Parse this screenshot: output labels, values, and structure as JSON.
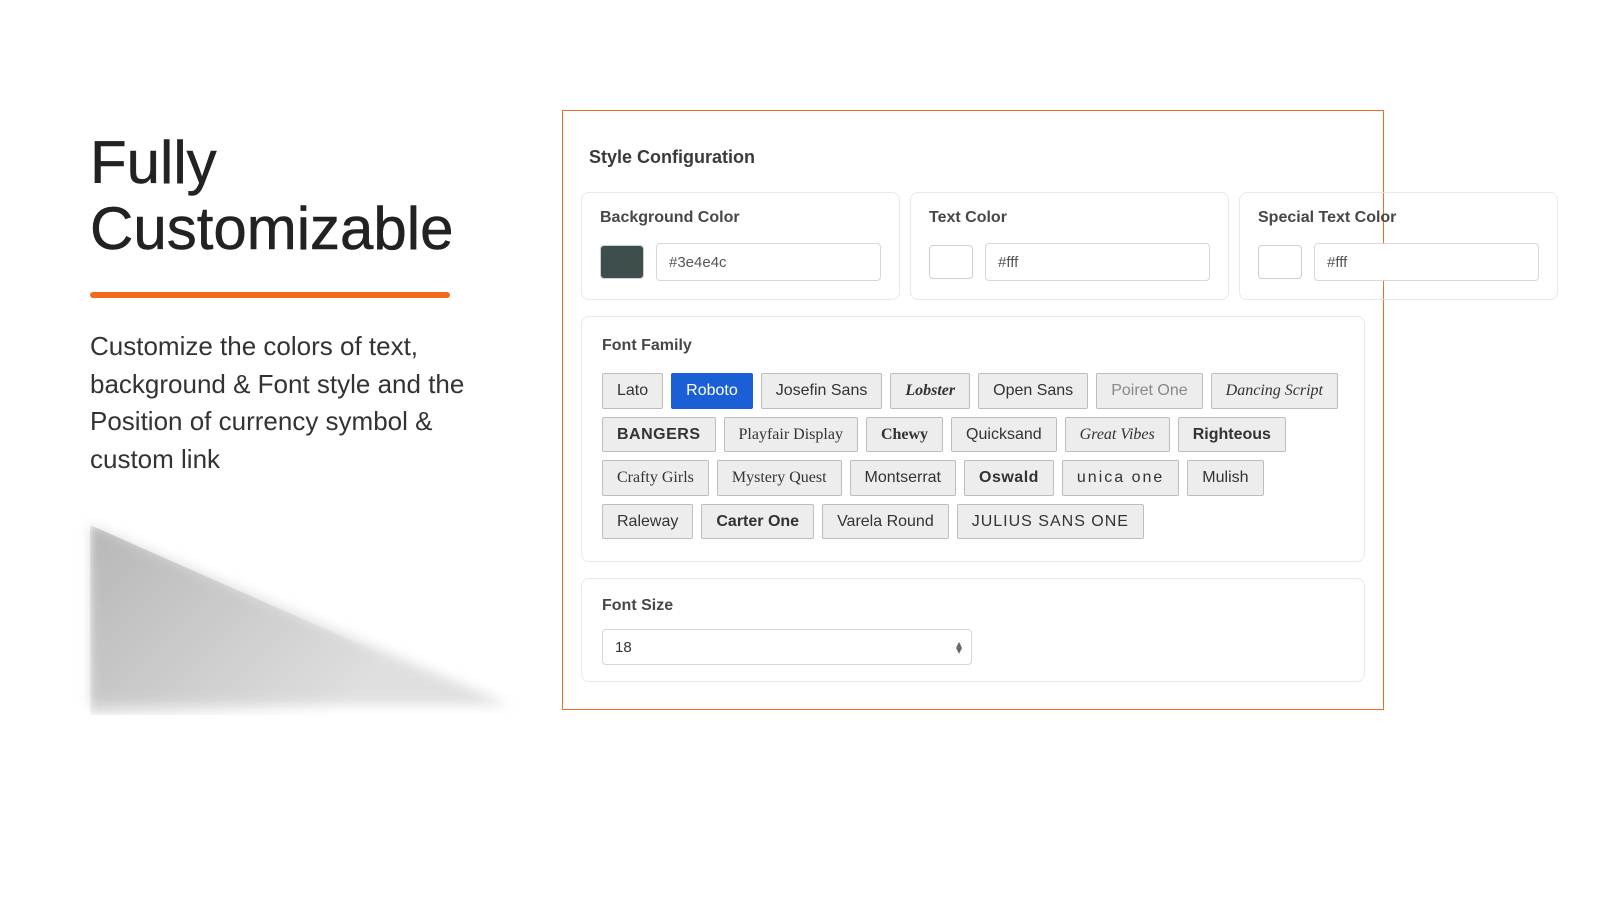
{
  "left": {
    "headline_line1": "Fully",
    "headline_line2": "Customizable",
    "description": "Customize the colors of text, background & Font style and the Position of currency symbol & custom link"
  },
  "panel": {
    "title": "Style Configuration",
    "colors": {
      "background": {
        "label": "Background Color",
        "value": "#3e4e4c",
        "swatch": "#3e4e4c"
      },
      "text": {
        "label": "Text Color",
        "value": "#fff",
        "swatch": "#ffffff"
      },
      "special": {
        "label": "Special Text Color",
        "value": "#fff",
        "swatch": "#ffffff"
      }
    },
    "font_family": {
      "label": "Font Family",
      "selected": "Roboto",
      "options": [
        "Lato",
        "Roboto",
        "Josefin Sans",
        "Lobster",
        "Open Sans",
        "Poiret One",
        "Dancing Script",
        "BANGERS",
        "Playfair Display",
        "Chewy",
        "Quicksand",
        "Great Vibes",
        "Righteous",
        "Crafty Girls",
        "Mystery Quest",
        "Montserrat",
        "Oswald",
        "unica one",
        "Mulish",
        "Raleway",
        "Carter One",
        "Varela Round",
        "JULIUS SANS ONE"
      ]
    },
    "font_size": {
      "label": "Font Size",
      "value": "18"
    }
  }
}
